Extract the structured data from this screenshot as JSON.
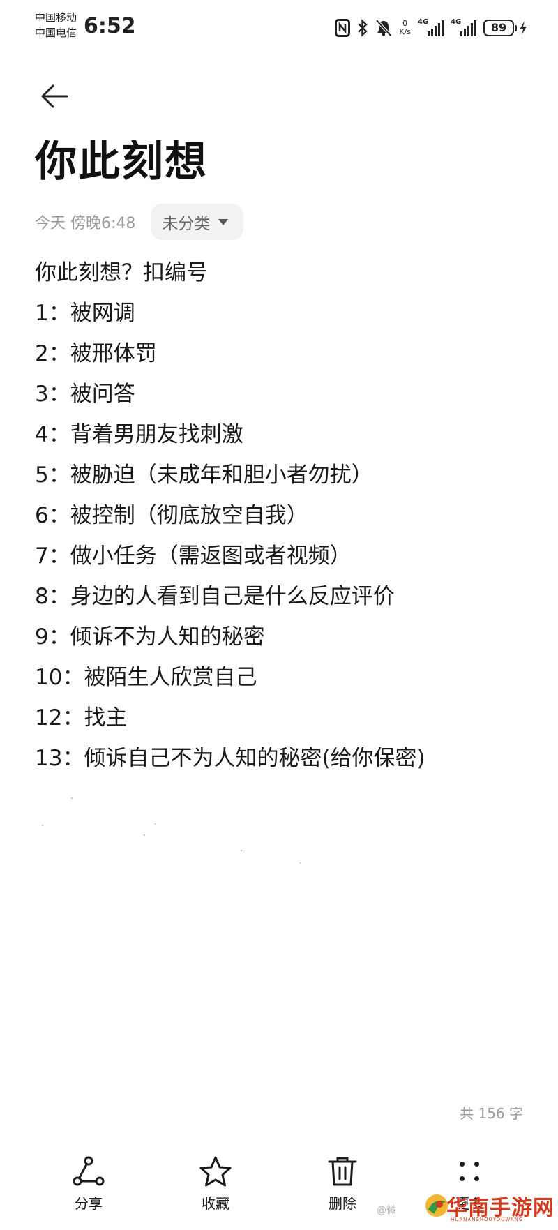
{
  "status_bar": {
    "carrier_1": "中国移动",
    "carrier_2": "中国电信",
    "time": "6:52",
    "net_speed_value": "0",
    "net_speed_unit": "K/s",
    "sim1_network": "4G",
    "sim2_network": "4G",
    "battery_level": "89"
  },
  "note": {
    "title": "你此刻想",
    "date": "今天 傍晚6:48",
    "category": "未分类",
    "lines": [
      "你此刻想？扣编号",
      "1：被网调",
      "2：被邢体罚",
      "3：被问答",
      "4：背着男朋友找刺激",
      "5：被胁迫（未成年和胆小者勿扰）",
      "6：被控制（彻底放空自我）",
      "7：做小任务（需返图或者视频）",
      "8：身边的人看到自己是什么反应评价",
      "9：倾诉不为人知的秘密",
      "10：被陌生人欣赏自己",
      "12：找主",
      "13：倾诉自己不为人知的秘密(给你保密)"
    ],
    "word_count": "共 156 字"
  },
  "toolbar": {
    "share_label": "分享",
    "favorite_label": "收藏",
    "delete_label": "删除",
    "more_label": "更多"
  },
  "watermark": {
    "weibo_prefix": "@微",
    "site_name": "华南手游网",
    "site_pinyin": "HUANANSHOUYOUWANG"
  },
  "colors": {
    "text_primary": "#1a1a1a",
    "text_secondary": "#9a9a9a",
    "chip_background": "#f2f2f2",
    "watermark_red": "#d23a1e"
  },
  "icons": {
    "back": "arrow-left-icon",
    "nfc": "nfc-icon",
    "bluetooth": "bluetooth-icon",
    "mute": "bell-off-icon",
    "share": "share-icon",
    "favorite": "star-icon",
    "delete": "trash-icon",
    "more": "dots-grid-icon"
  }
}
